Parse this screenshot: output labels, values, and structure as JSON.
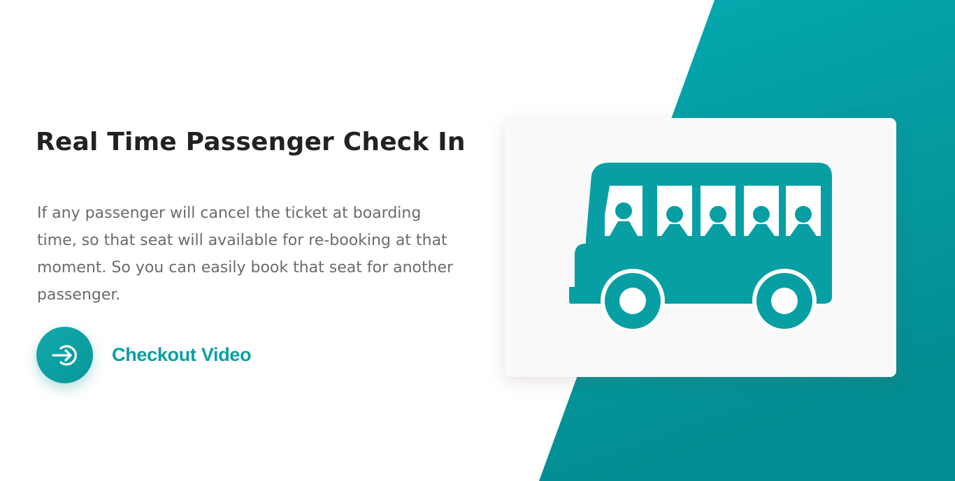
{
  "feature": {
    "title": "Real Time Passenger Check In",
    "description": "If any passenger will cancel the ticket at boarding time, so that seat will available for re-booking at that moment. So you can easily book that seat for another passenger.",
    "cta_label": "Checkout Video"
  },
  "icons": {
    "cta": "play-login-arrow-icon",
    "illustration": "bus-with-passengers-icon"
  },
  "colors": {
    "accent": "#0a9fa2",
    "heading": "#222222",
    "body_text": "#6b6b6b",
    "card_bg": "#f9f9f9"
  }
}
